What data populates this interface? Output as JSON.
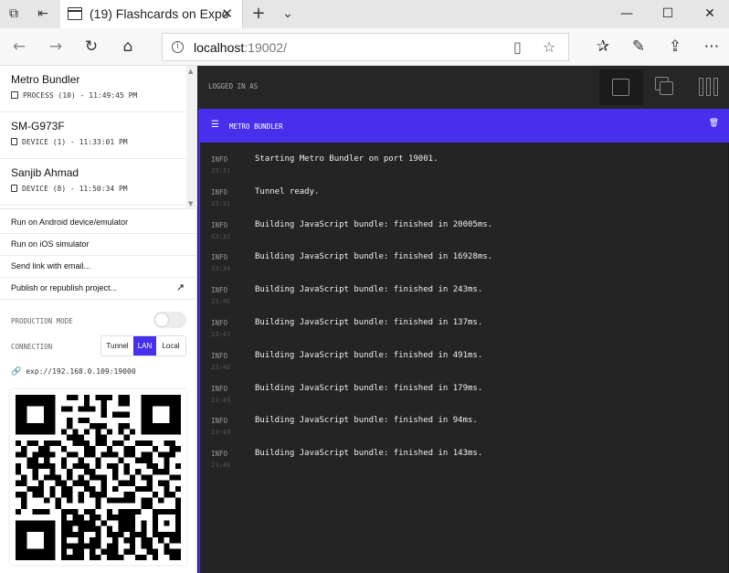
{
  "browser": {
    "tab_title": "(19) Flashcards on Expo",
    "url_host": "localhost",
    "url_port": ":19002/"
  },
  "sidebar": {
    "devices": [
      {
        "name": "Metro Bundler",
        "subtitle": "PROCESS (10) - 11:49:45 PM"
      },
      {
        "name": "SM-G973F",
        "subtitle": "DEVICE (1) - 11:33:01 PM"
      },
      {
        "name": "Sanjib Ahmad",
        "subtitle": "DEVICE (8) - 11:50:34 PM"
      }
    ],
    "actions": [
      {
        "label": "Run on Android device/emulator"
      },
      {
        "label": "Run on iOS simulator"
      },
      {
        "label": "Send link with email..."
      },
      {
        "label": "Publish or republish project..."
      }
    ],
    "production_mode_label": "PRODUCTION MODE",
    "production_mode_on": false,
    "connection_label": "CONNECTION",
    "connection_options": [
      "Tunnel",
      "LAN",
      "Local"
    ],
    "connection_selected": "LAN",
    "exp_url": "exp://192.168.0.109:19000"
  },
  "main": {
    "logged_in_label": "LOGGED IN AS",
    "panel_title": "METRO BUNDLER",
    "logs": [
      {
        "level": "INFO",
        "time": "23:31",
        "message": "Starting Metro Bundler on port 19001."
      },
      {
        "level": "INFO",
        "time": "23:31",
        "message": "Tunnel ready."
      },
      {
        "level": "INFO",
        "time": "23:32",
        "message": "Building JavaScript bundle: finished in 20005ms."
      },
      {
        "level": "INFO",
        "time": "23:34",
        "message": "Building JavaScript bundle: finished in 16928ms."
      },
      {
        "level": "INFO",
        "time": "23:46",
        "message": "Building JavaScript bundle: finished in 243ms."
      },
      {
        "level": "INFO",
        "time": "23:47",
        "message": "Building JavaScript bundle: finished in 137ms."
      },
      {
        "level": "INFO",
        "time": "23:48",
        "message": "Building JavaScript bundle: finished in 491ms."
      },
      {
        "level": "INFO",
        "time": "23:49",
        "message": "Building JavaScript bundle: finished in 179ms."
      },
      {
        "level": "INFO",
        "time": "23:49",
        "message": "Building JavaScript bundle: finished in 94ms."
      },
      {
        "level": "INFO",
        "time": "23:49",
        "message": "Building JavaScript bundle: finished in 143ms."
      }
    ]
  },
  "colors": {
    "accent": "#4630eb",
    "console_bg": "#242424"
  }
}
